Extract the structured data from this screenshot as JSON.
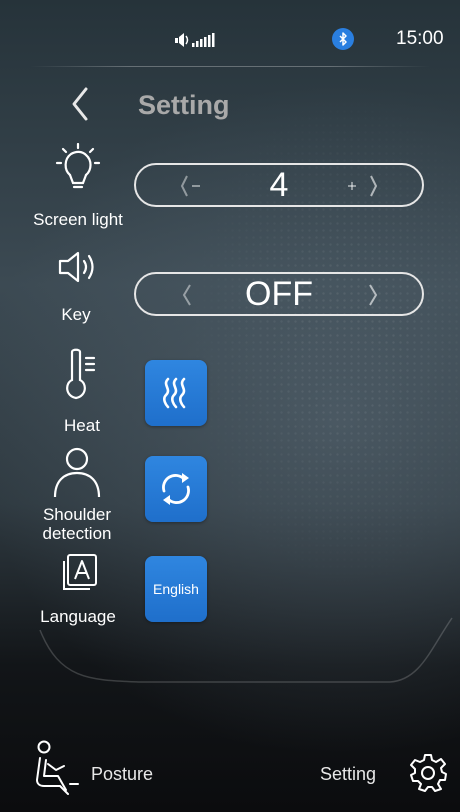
{
  "status_bar": {
    "time": "15:00",
    "icons": [
      "volume-signal-icon",
      "bluetooth-icon"
    ]
  },
  "header": {
    "title": "Setting",
    "back_icon": "chevron-left-icon"
  },
  "settings": {
    "screen_light": {
      "label": "Screen light",
      "value": "4",
      "icon": "bulb-icon"
    },
    "key": {
      "label": "Key",
      "value": "OFF",
      "icon": "speaker-icon"
    },
    "heat": {
      "label": "Heat",
      "icon": "thermometer-icon",
      "tile_icon": "heat-waves-icon"
    },
    "shoulder_detection": {
      "label_line1": "Shoulder",
      "label_line2": "detection",
      "icon": "person-icon",
      "tile_icon": "refresh-icon"
    },
    "language": {
      "label": "Language",
      "value": "English",
      "icon": "language-icon"
    }
  },
  "bottom_nav": {
    "posture_label": "Posture",
    "setting_label": "Setting",
    "posture_icon": "seated-person-icon",
    "setting_icon": "gear-icon"
  },
  "colors": {
    "accent_blue": "#2a7fe0",
    "title_gray": "#a9a9a9",
    "background_dark": "#26333a"
  }
}
